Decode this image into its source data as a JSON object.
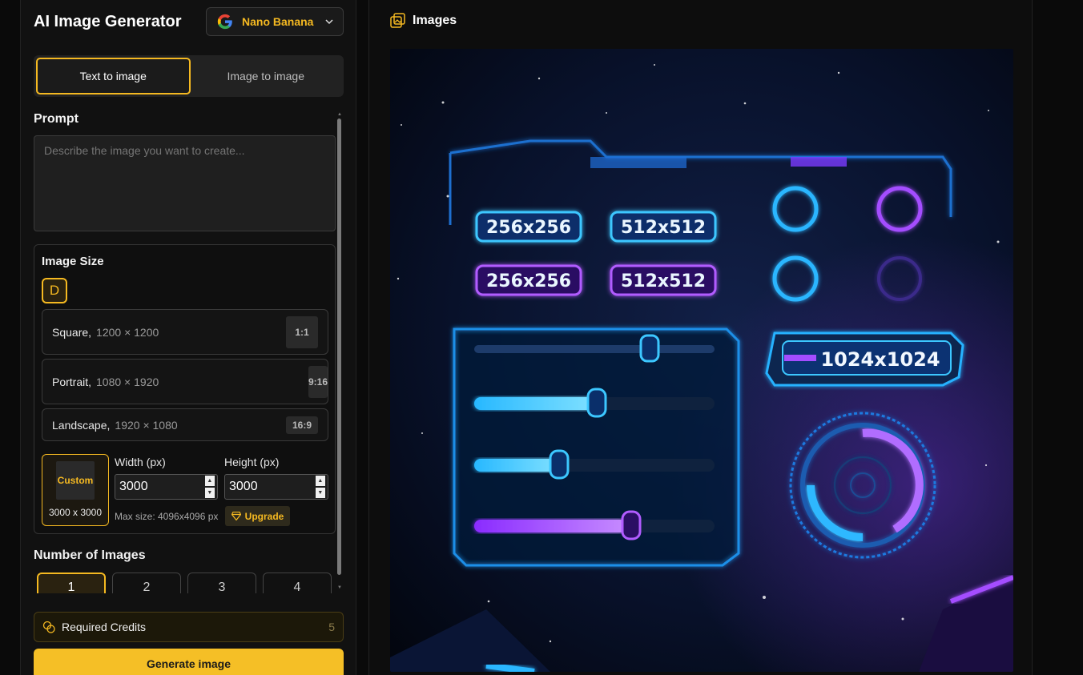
{
  "app": {
    "title": "AI Image Generator"
  },
  "model": {
    "name": "Nano Banana",
    "icon": "google-g-icon"
  },
  "mode_tabs": [
    {
      "label": "Text to image",
      "active": true
    },
    {
      "label": "Image to image",
      "active": false
    }
  ],
  "prompt": {
    "title": "Prompt",
    "placeholder": "Describe the image you want to create..."
  },
  "image_size": {
    "title": "Image Size",
    "badge": "D",
    "presets": [
      {
        "name": "Square,",
        "dims": "1200 × 1200",
        "ratio": "1:1"
      },
      {
        "name": "Portrait,",
        "dims": "1080 × 1920",
        "ratio": "9:16"
      },
      {
        "name": "Landscape,",
        "dims": "1920 × 1080",
        "ratio": "16:9"
      }
    ],
    "custom": {
      "label": "Custom",
      "dims": "3000 x 3000",
      "width_label": "Width (px)",
      "height_label": "Height (px)",
      "width_value": "3000",
      "height_value": "3000",
      "max_size": "Max size: 4096x4096 px",
      "upgrade_label": "Upgrade"
    }
  },
  "num_images": {
    "title": "Number of Images",
    "options": [
      "1",
      "2",
      "3",
      "4"
    ],
    "selected": "1"
  },
  "credits": {
    "label": "Required Credits",
    "value": "5"
  },
  "generate": {
    "label": "Generate image"
  },
  "images_panel": {
    "title": "Images",
    "generated_image": {
      "labels": [
        "256x256",
        "512x512",
        "256x256",
        "512x512",
        "1024x1024"
      ]
    }
  },
  "colors": {
    "accent": "#f5b921",
    "cyan": "#29c8ff",
    "purple": "#9b3dff"
  }
}
